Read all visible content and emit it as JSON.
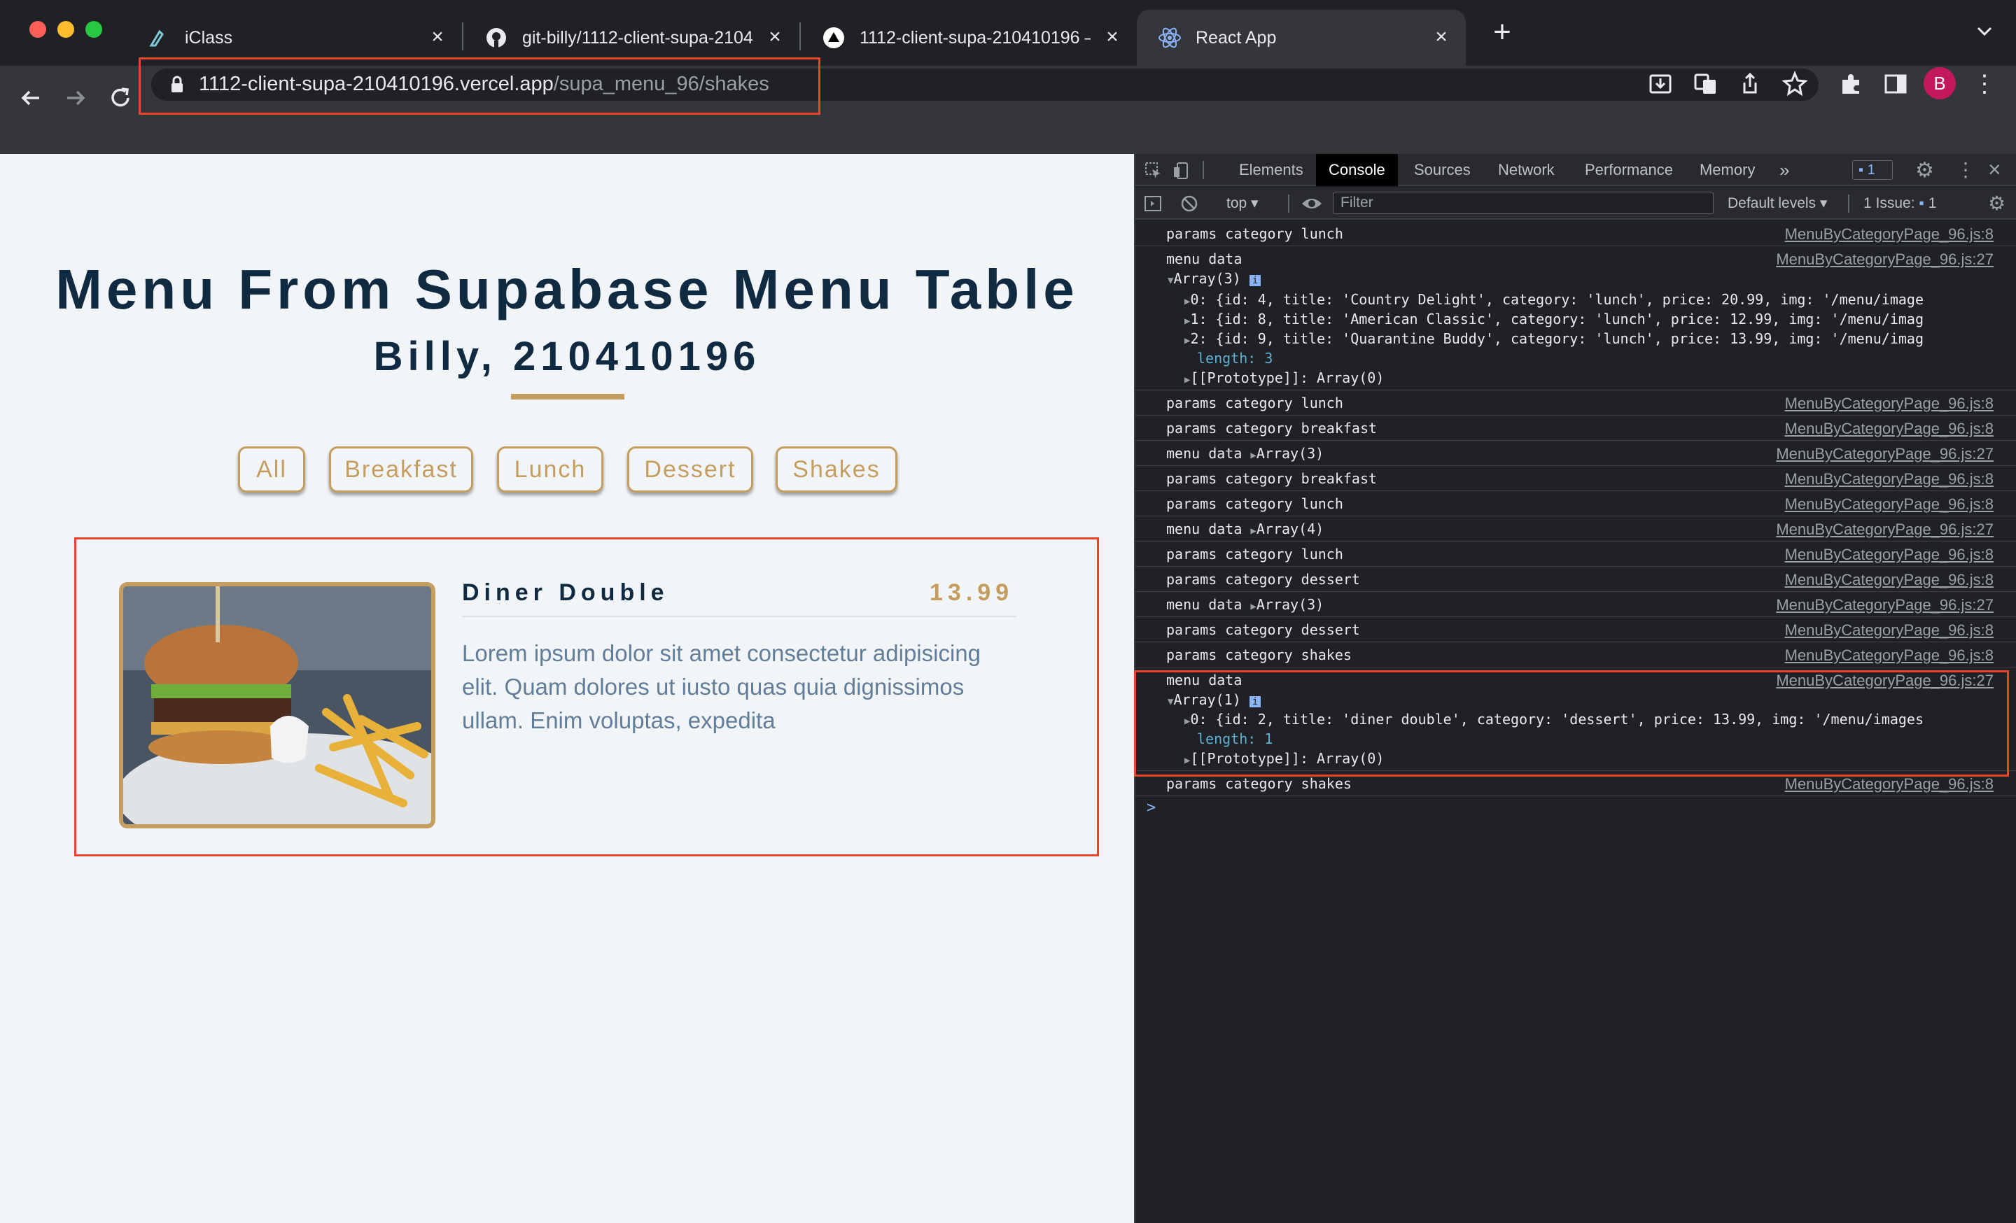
{
  "browser": {
    "tabs": [
      {
        "title": "iClass",
        "icon": "iclass-icon"
      },
      {
        "title": "git-billy/1112-client-supa-2104",
        "icon": "github-icon"
      },
      {
        "title": "1112-client-supa-210410196 –",
        "icon": "vercel-icon"
      },
      {
        "title": "React App",
        "icon": "react-icon"
      }
    ],
    "new_tab": "+",
    "url_host": "1112-client-supa-210410196.vercel.app",
    "url_path": "/supa_menu_96/shakes",
    "profile_initial": "B"
  },
  "page": {
    "title": "Menu From Supabase Menu Table",
    "subtitle": "Billy, 210410196",
    "filters": [
      "All",
      "Breakfast",
      "Lunch",
      "Dessert",
      "Shakes"
    ],
    "item": {
      "title": "Diner Double",
      "price": "13.99",
      "desc": "Lorem ipsum dolor sit amet consectetur adipisicing elit. Quam dolores ut iusto quas quia dignissimos ullam. Enim voluptas, expedita"
    }
  },
  "devtools": {
    "tabs": [
      "Elements",
      "Console",
      "Sources",
      "Network",
      "Performance",
      "Memory"
    ],
    "issues_badge": "1",
    "context": "top",
    "filter_placeholder": "Filter",
    "levels": "Default levels",
    "issue_count": "1 Issue:",
    "issue_num": "1",
    "src8": "MenuByCategoryPage_96.js:8",
    "src27": "MenuByCategoryPage_96.js:27",
    "lines": {
      "l1": "params category lunch",
      "l2": "menu data",
      "arr3": "Array(3)",
      "r0": "0: {id: 4, title: 'Country Delight', category: 'lunch', price: 20.99, img: '/menu/image",
      "r1": "1: {id: 8, title: 'American Classic', category: 'lunch', price: 12.99, img: '/menu/imag",
      "r2": "2: {id: 9, title: 'Quarantine Buddy', category: 'lunch', price: 13.99, img: '/menu/imag",
      "len3": "length: 3",
      "proto": "[[Prototype]]: Array(0)",
      "l3": "params category lunch",
      "l4": "params category breakfast",
      "l5": "menu data",
      "l5a": "Array(3)",
      "l6": "params category breakfast",
      "l7": "params category lunch",
      "l8": "menu data",
      "l8a": "Array(4)",
      "l9": "params category lunch",
      "l10": "params category dessert",
      "l11": "menu data",
      "l11a": "Array(3)",
      "l12": "params category dessert",
      "l13": "params category shakes",
      "l14": "menu data",
      "arr1": "Array(1)",
      "s0": "0: {id: 2, title: 'diner double', category: 'dessert', price: 13.99, img: '/menu/images",
      "len1": "length: 1",
      "proto2": "[[Prototype]]: Array(0)",
      "l15": "params category shakes",
      "prompt": ">"
    }
  },
  "colors": {
    "accent": "#c59d5f",
    "heading": "#102a42",
    "highlight": "#e8452c",
    "page_bg": "#f2f5f8"
  }
}
